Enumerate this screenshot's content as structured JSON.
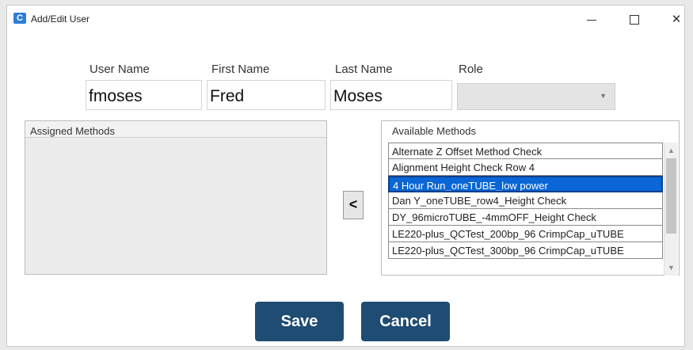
{
  "window": {
    "title": "Add/Edit User",
    "controls": {
      "minimize": "",
      "maximize": "",
      "close": "✕"
    }
  },
  "form": {
    "user_name": {
      "label": "User Name",
      "value": "fmoses"
    },
    "first_name": {
      "label": "First Name",
      "value": "Fred"
    },
    "last_name": {
      "label": "Last Name",
      "value": "Moses"
    },
    "role": {
      "label": "Role",
      "value": ""
    }
  },
  "assigned_methods": {
    "header": "Assigned Methods",
    "items": []
  },
  "available_methods": {
    "header": "Available Methods",
    "items": [
      "Alternate Z Offset Method Check",
      "Alignment Height Check Row 4",
      "4 Hour Run_oneTUBE_low power",
      "Dan Y_oneTUBE_row4_Height Check",
      "DY_96microTUBE_-4mmOFF_Height Check",
      "LE220-plus_QCTest_200bp_96 CrimpCap_uTUBE",
      "LE220-plus_QCTest_300bp_96 CrimpCap_uTUBE"
    ],
    "selected_index": 2
  },
  "move_button_label": "<",
  "buttons": {
    "save": "Save",
    "cancel": "Cancel"
  },
  "colors": {
    "accent_button": "#1e4c72",
    "selection": "#0a66d6"
  },
  "icons": {
    "app": "app-logo-icon",
    "dropdown": "chevron-down-icon",
    "scroll_up": "chevron-up-icon",
    "scroll_down": "chevron-down-icon"
  }
}
